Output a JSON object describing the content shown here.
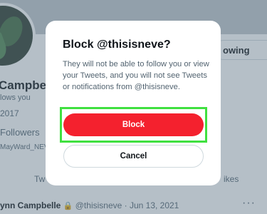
{
  "background": {
    "following_label": "owing",
    "profile_name": "Campbelle",
    "follows_you": "lows you",
    "joined_year": "2017",
    "followers_label": "Followers",
    "followed_by": "MayWard_NEV",
    "tab_left": "Tw",
    "tab_right": "ikes",
    "tweet": {
      "name": "ynn Campbelle",
      "lock_icon": "🔒",
      "handle": "@thisisneve · Jun 13, 2021",
      "more": "···"
    }
  },
  "dialog": {
    "title": "Block @thisisneve?",
    "message": "They will not be able to follow you or view your Tweets, and you will not see Tweets or notifications from @thisisneve.",
    "block_label": "Block",
    "cancel_label": "Cancel"
  },
  "colors": {
    "block_button": "#f4212e",
    "highlight": "#40e040",
    "overlay": "#5b7083"
  }
}
